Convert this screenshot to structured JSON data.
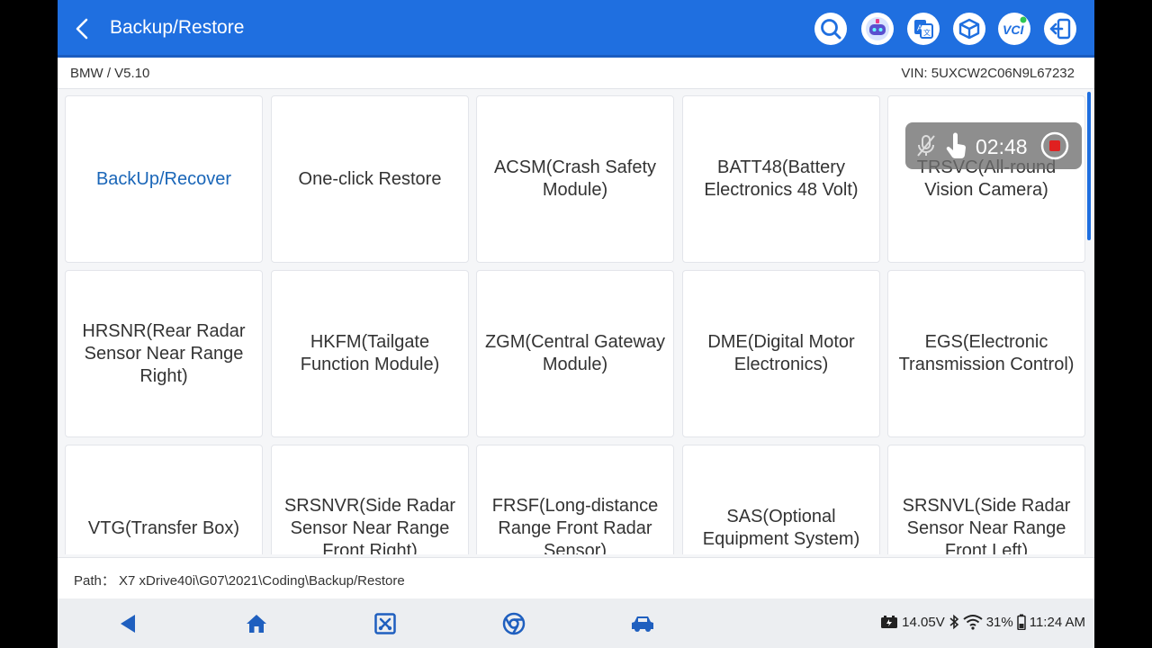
{
  "header": {
    "title": "Backup/Restore",
    "icons": [
      "search-icon",
      "ai-assistant-icon",
      "translate-icon",
      "package-icon",
      "vci-icon",
      "exit-icon"
    ],
    "vci_label": "VCI"
  },
  "info": {
    "vehicle": "BMW / V5.10",
    "vin": "VIN: 5UXCW2C06N9L67232"
  },
  "tiles": [
    "BackUp/Recover",
    "One-click Restore",
    "ACSM(Crash Safety Module)",
    "BATT48(Battery Electronics 48 Volt)",
    "TRSVC(All-round Vision Camera)",
    "HRSNR(Rear Radar Sensor Near Range Right)",
    "HKFM(Tailgate Function Module)",
    "ZGM(Central Gateway Module)",
    "DME(Digital Motor Electronics)",
    "EGS(Electronic Transmission Control)",
    "VTG(Transfer Box)",
    "SRSNVR(Side Radar Sensor Near Range Front Right)",
    "FRSF(Long-distance Range Front Radar Sensor)",
    "SAS(Optional Equipment System)",
    "SRSNVL(Side Radar Sensor Near Range Front Left)"
  ],
  "recorder": {
    "time": "02:48"
  },
  "path": "Path： X7 xDrive40i\\G07\\2021\\Coding\\Backup/Restore",
  "status": {
    "voltage": "14.05V",
    "battery": "31%",
    "time": "11:24 AM"
  },
  "colors": {
    "primary": "#1f6fe0",
    "active_text": "#1a66b8",
    "record_red": "#e02020"
  }
}
